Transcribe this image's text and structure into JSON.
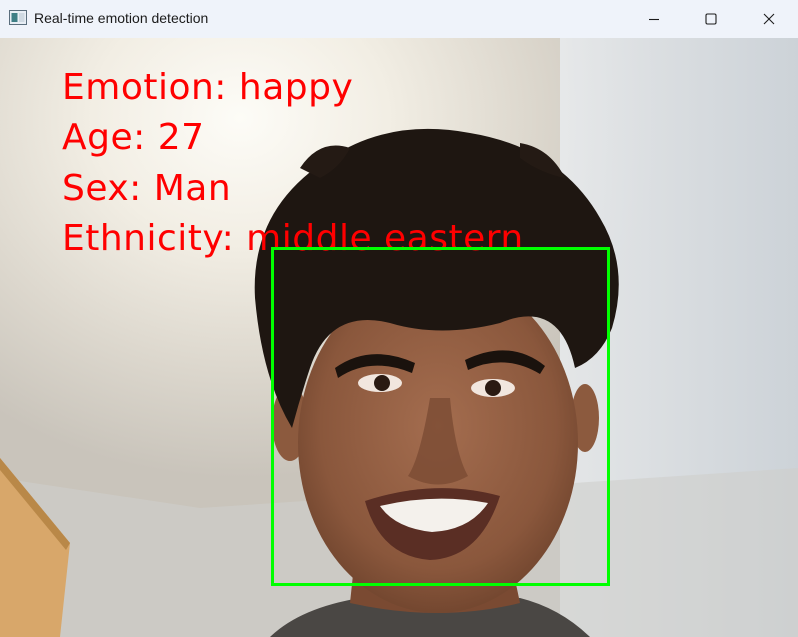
{
  "window": {
    "title": "Real-time emotion detection",
    "controls": [
      "minimize",
      "maximize",
      "close"
    ]
  },
  "overlay": {
    "emotion": "Emotion: happy",
    "age": "Age: 27",
    "sex": "Sex: Man",
    "ethnicity": "Ethnicity: middle eastern",
    "text_color": "#ff0000",
    "box_color": "#00ff00"
  },
  "colors": {
    "titlebar_bg": "#eff3fa"
  }
}
